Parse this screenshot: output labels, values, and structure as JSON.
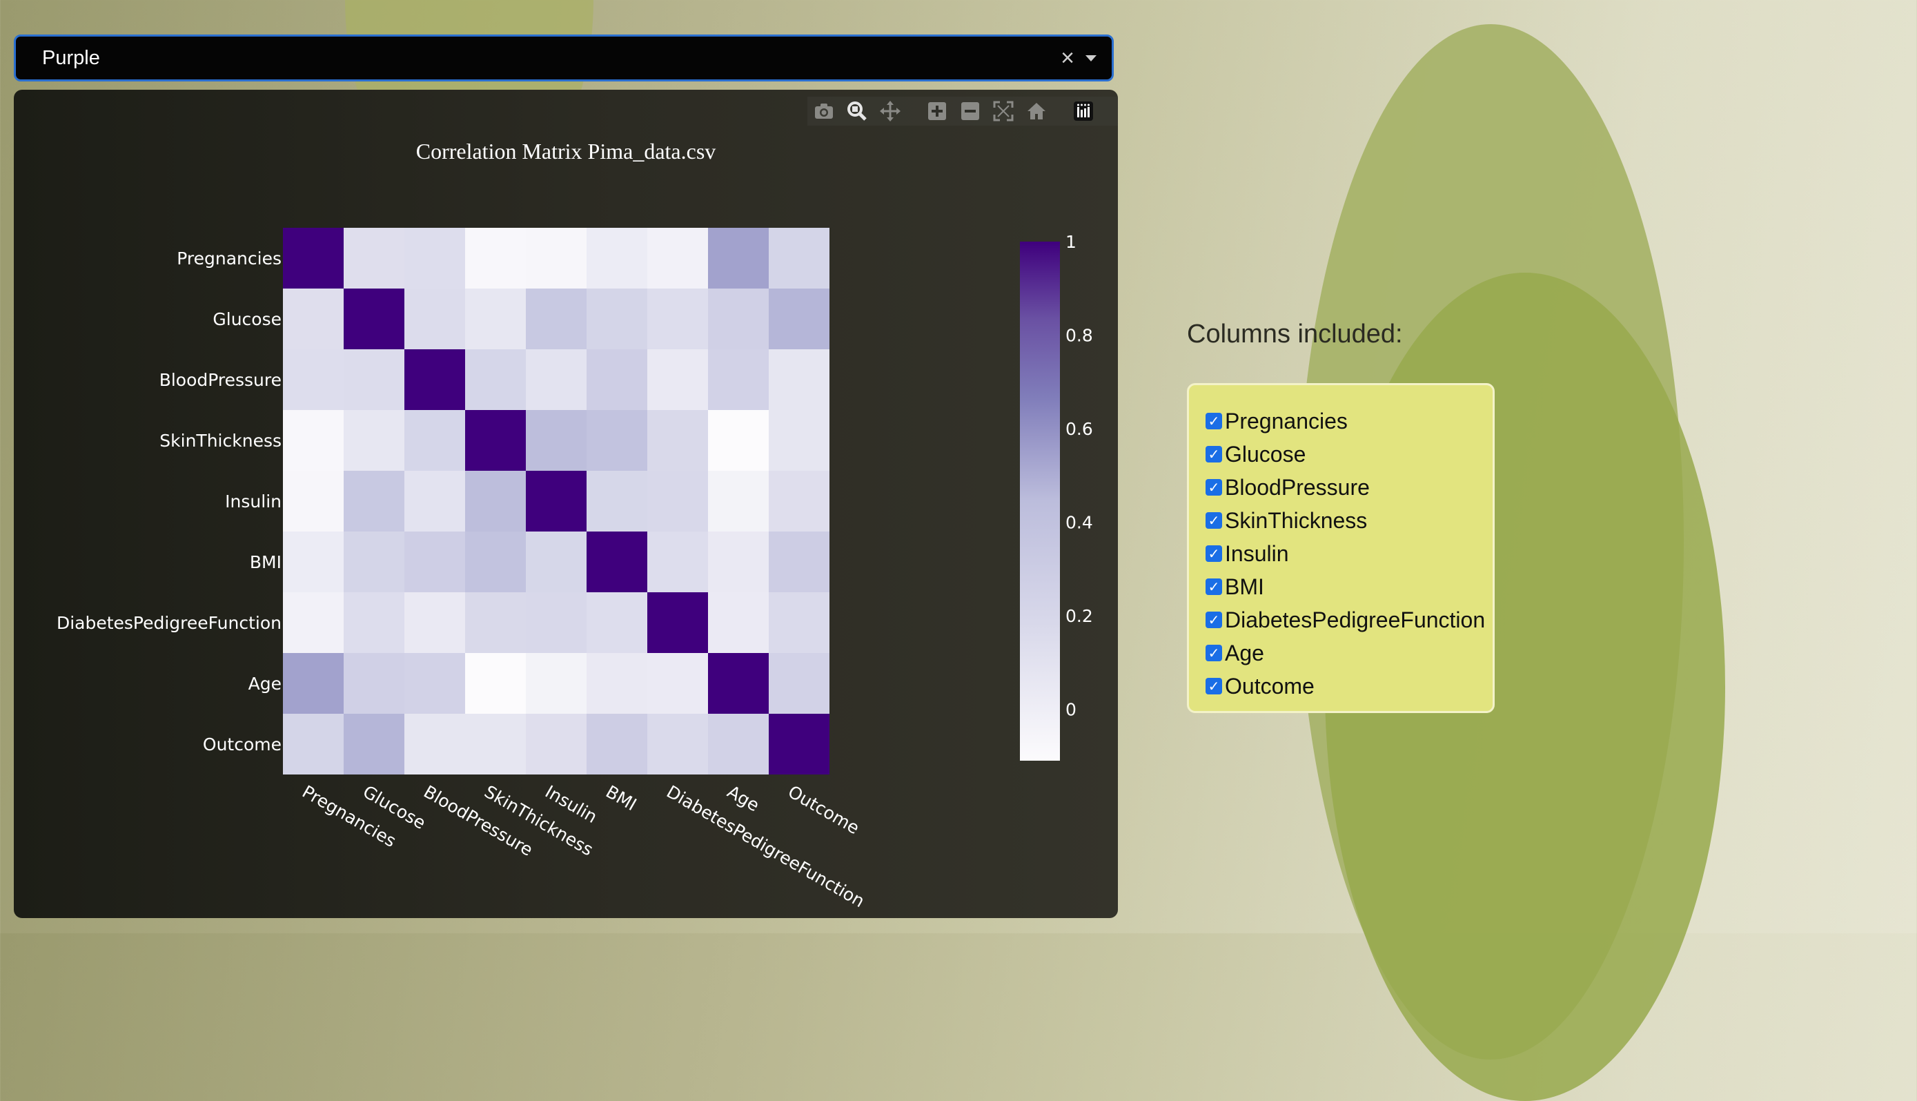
{
  "dropdown": {
    "value": "Purple",
    "clear_glyph": "×"
  },
  "modebar": {
    "icons": [
      "camera-icon",
      "zoom-icon",
      "pan-icon",
      "zoom-in-icon",
      "zoom-out-icon",
      "autoscale-icon",
      "reset-axes-icon",
      "plotly-logo-icon"
    ]
  },
  "chart_data": {
    "type": "heatmap",
    "title": "Correlation Matrix  Pima_data.csv",
    "colorscale": "Purples",
    "categories": [
      "Pregnancies",
      "Glucose",
      "BloodPressure",
      "SkinThickness",
      "Insulin",
      "BMI",
      "DiabetesPedigreeFunction",
      "Age",
      "Outcome"
    ],
    "z": [
      [
        1.0,
        0.13,
        0.14,
        -0.08,
        -0.07,
        0.02,
        -0.03,
        0.54,
        0.22
      ],
      [
        0.13,
        1.0,
        0.15,
        0.06,
        0.33,
        0.22,
        0.14,
        0.26,
        0.47
      ],
      [
        0.14,
        0.15,
        1.0,
        0.21,
        0.09,
        0.28,
        0.04,
        0.24,
        0.07
      ],
      [
        -0.08,
        0.06,
        0.21,
        1.0,
        0.44,
        0.39,
        0.18,
        -0.11,
        0.07
      ],
      [
        -0.07,
        0.33,
        0.09,
        0.44,
        1.0,
        0.2,
        0.19,
        -0.04,
        0.13
      ],
      [
        0.02,
        0.22,
        0.28,
        0.39,
        0.2,
        1.0,
        0.14,
        0.04,
        0.29
      ],
      [
        -0.03,
        0.14,
        0.04,
        0.18,
        0.19,
        0.14,
        1.0,
        0.03,
        0.17
      ],
      [
        0.54,
        0.26,
        0.24,
        -0.11,
        -0.04,
        0.04,
        0.03,
        1.0,
        0.24
      ],
      [
        0.22,
        0.47,
        0.07,
        0.07,
        0.13,
        0.29,
        0.17,
        0.24,
        1.0
      ]
    ],
    "colorbar": {
      "min": -0.11,
      "max": 1,
      "ticks": [
        0,
        0.2,
        0.4,
        0.6,
        0.8,
        1
      ],
      "tick_labels": [
        "0",
        "0.2",
        "0.4",
        "0.6",
        "0.8",
        "1"
      ]
    }
  },
  "columns_panel": {
    "title": "Columns included:",
    "items": [
      {
        "label": "Pregnancies",
        "checked": true
      },
      {
        "label": "Glucose",
        "checked": true
      },
      {
        "label": "BloodPressure",
        "checked": true
      },
      {
        "label": "SkinThickness",
        "checked": true
      },
      {
        "label": "Insulin",
        "checked": true
      },
      {
        "label": "BMI",
        "checked": true
      },
      {
        "label": "DiabetesPedigreeFunction",
        "checked": true
      },
      {
        "label": "Age",
        "checked": true
      },
      {
        "label": "Outcome",
        "checked": true
      }
    ],
    "check_glyph": "✓"
  }
}
